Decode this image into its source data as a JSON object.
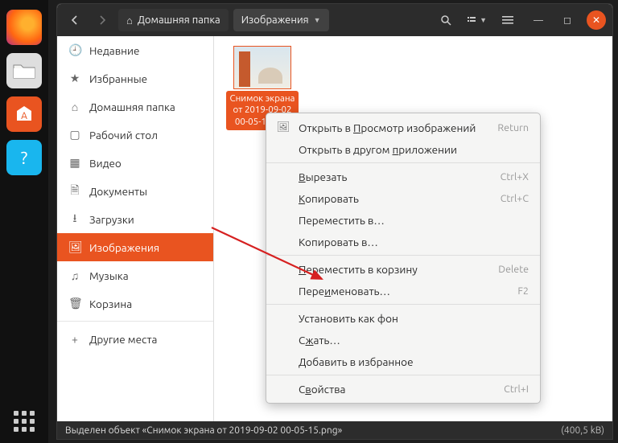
{
  "titlebar": {
    "home_label": "Домашняя папка",
    "location_label": "Изображения"
  },
  "sidebar": {
    "items": [
      {
        "icon": "🕘",
        "label": "Недавние"
      },
      {
        "icon": "★",
        "label": "Избранные"
      },
      {
        "icon": "⌂",
        "label": "Домашняя папка"
      },
      {
        "icon": "▢",
        "label": "Рабочий стол"
      },
      {
        "icon": "▦",
        "label": "Видео"
      },
      {
        "icon": "🗎",
        "label": "Документы"
      },
      {
        "icon": "⭳",
        "label": "Загрузки"
      },
      {
        "icon": "🖼",
        "label": "Изображения"
      },
      {
        "icon": "♫",
        "label": "Музыка"
      },
      {
        "icon": "🗑",
        "label": "Корзина"
      }
    ],
    "other_places": "Другие места",
    "active_index": 7
  },
  "file": {
    "label": "Снимок экрана от 2019-09-02 00-05-15.png"
  },
  "context_menu": {
    "items": [
      {
        "type": "item",
        "icon": "🖼",
        "label_pre": "Открыть в ",
        "u": "П",
        "label_post": "росмотр изображений",
        "accel": "Return"
      },
      {
        "type": "item",
        "label_pre": "Открыть в другом ",
        "u": "п",
        "label_post": "риложении"
      },
      {
        "type": "sep"
      },
      {
        "type": "item",
        "u": "В",
        "label_post": "ырезать",
        "accel": "Ctrl+X"
      },
      {
        "type": "item",
        "u": "К",
        "label_post": "опировать",
        "accel": "Ctrl+C"
      },
      {
        "type": "item",
        "label_pre": "Переместить в…"
      },
      {
        "type": "item",
        "label_pre": "Копировать в…"
      },
      {
        "type": "sep"
      },
      {
        "type": "item",
        "u": "П",
        "label_post": "ереместить в корзину",
        "accel": "Delete"
      },
      {
        "type": "item",
        "label_pre": "Пере",
        "u": "и",
        "label_post": "меновать…",
        "accel": "F2"
      },
      {
        "type": "sep"
      },
      {
        "type": "item",
        "label_pre": "Установить как фон"
      },
      {
        "type": "item",
        "label_pre": "С",
        "u": "ж",
        "label_post": "ать…"
      },
      {
        "type": "item",
        "label_pre": "Добавить в избранное"
      },
      {
        "type": "sep"
      },
      {
        "type": "item",
        "label_pre": "С",
        "u": "в",
        "label_post": "ойства",
        "accel": "Ctrl+I"
      }
    ]
  },
  "statusbar": {
    "text": "Выделен объект «Снимок экрана от 2019-09-02 00-05-15.png»",
    "size": "(400,5 kB)"
  }
}
